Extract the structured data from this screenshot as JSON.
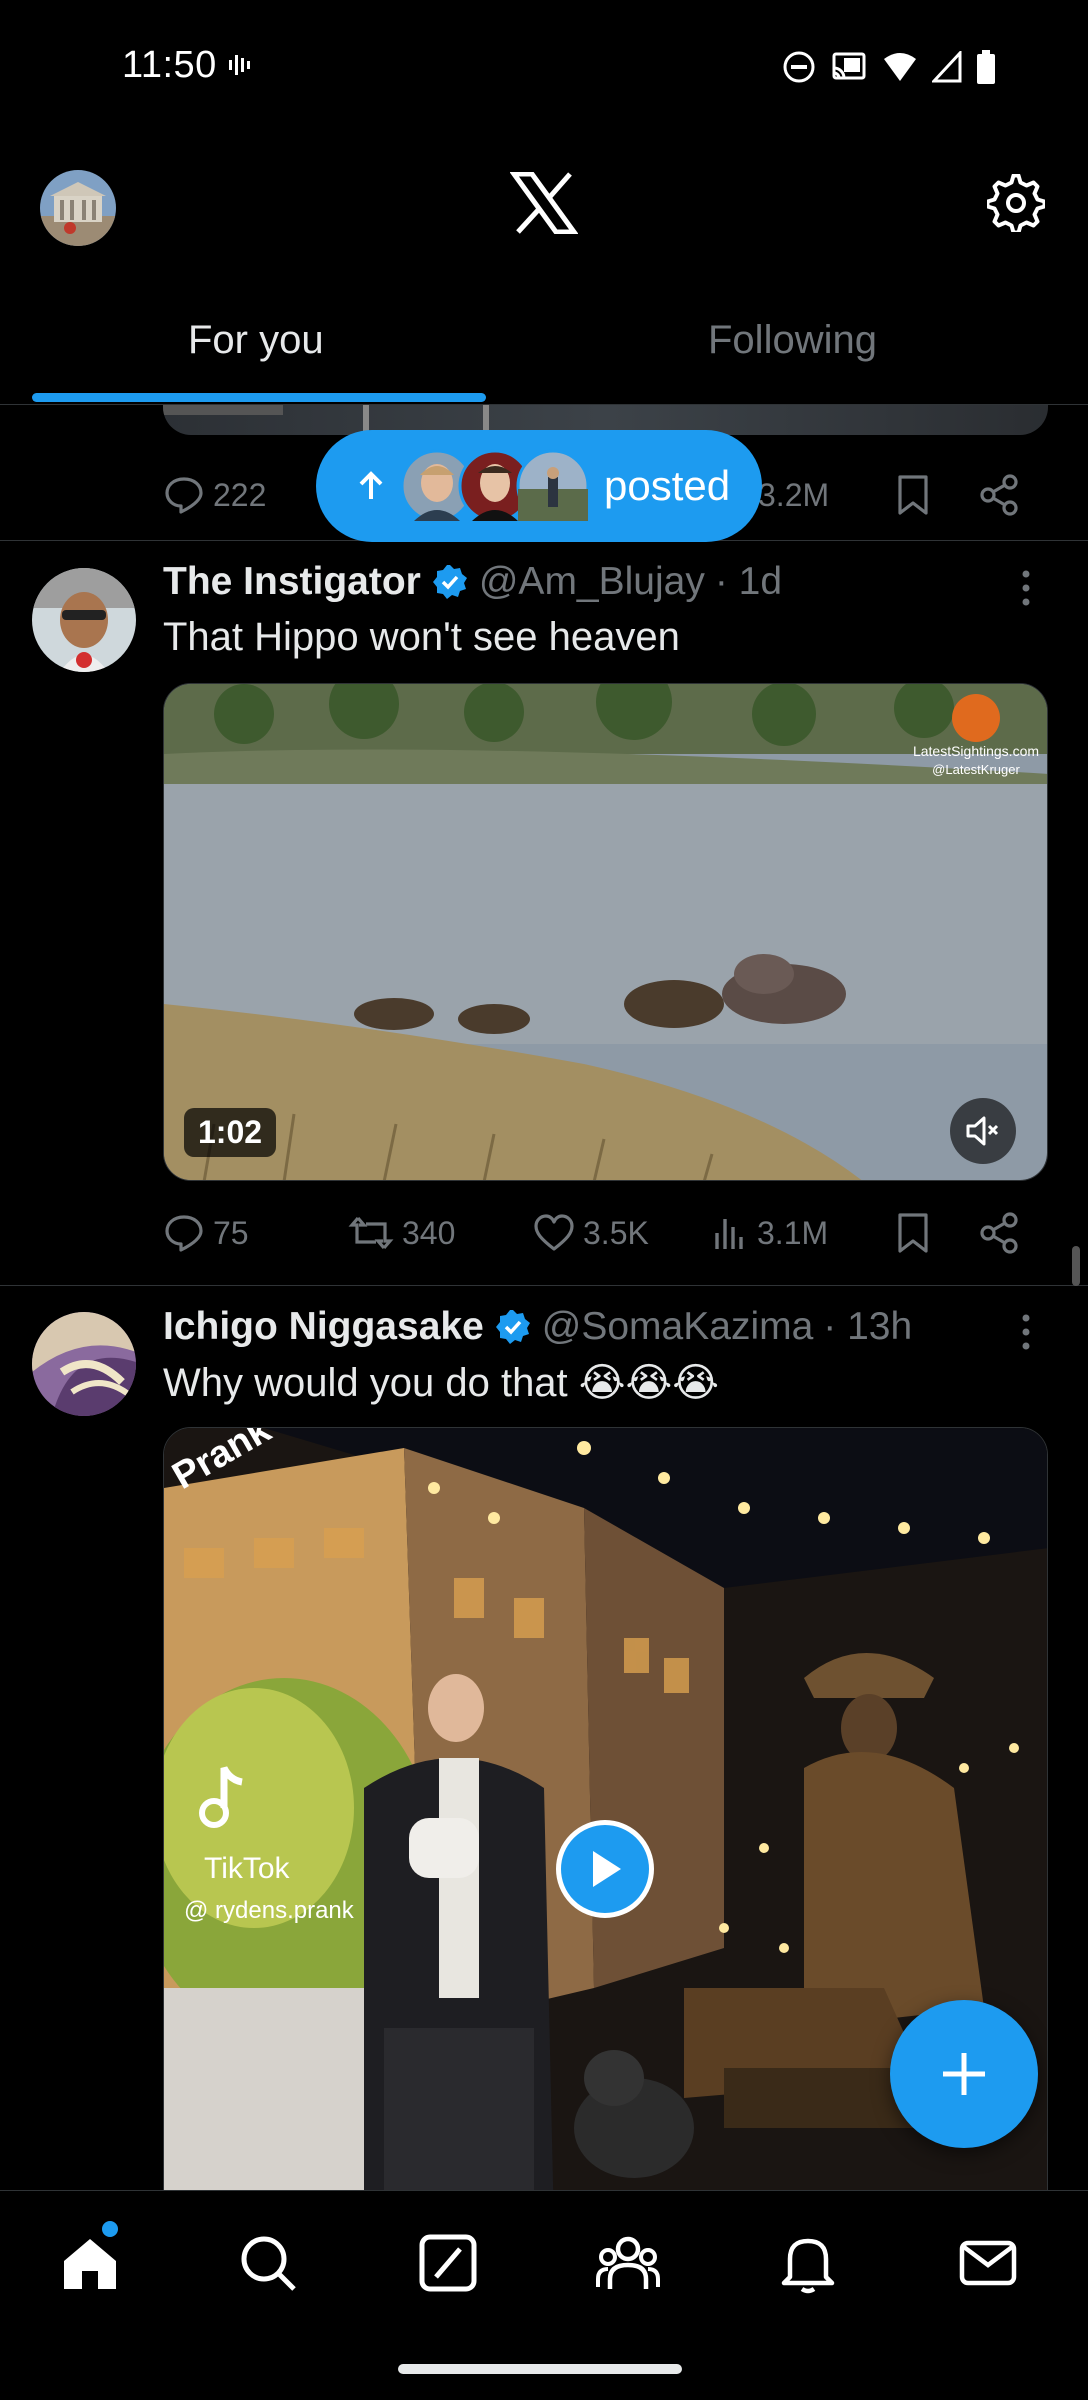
{
  "status_bar": {
    "time": "11:50"
  },
  "header": {
    "logo": "x-logo-icon",
    "settings_icon": "gear-icon"
  },
  "tabs": [
    {
      "label": "For you",
      "selected": true
    },
    {
      "label": "Following",
      "selected": false
    }
  ],
  "previous_tweet": {
    "replies": "222",
    "views": "3.2M"
  },
  "new_posts_pill": {
    "label": "posted"
  },
  "tweets": [
    {
      "name": "The Instigator",
      "verified": true,
      "handle": "@Am_Blujay",
      "time": "· 1d",
      "text": "That Hippo won't see heaven",
      "media": {
        "duration": "1:02",
        "watermark": "LatestSightings.com",
        "watermark_handle": "@LatestKruger"
      },
      "replies": "75",
      "reposts": "340",
      "likes": "3.5K",
      "views": "3.1M"
    },
    {
      "name": "Ichigo Niggasake",
      "verified": true,
      "handle": "@SomaKazima",
      "time": "· 13h",
      "text": "Why would you do that 😭😭😭",
      "media": {
        "corner_text": "Prank",
        "tiktok_label": "TikTok",
        "tiktok_handle": "@ rydens.prank"
      }
    }
  ],
  "bottom_nav": [
    "home-icon",
    "search-icon",
    "grok-icon",
    "communities-icon",
    "notifications-icon",
    "messages-icon"
  ],
  "colors": {
    "accent": "#1d9bf0",
    "background": "#000000",
    "muted": "#71767b",
    "text": "#e7e9ea"
  }
}
